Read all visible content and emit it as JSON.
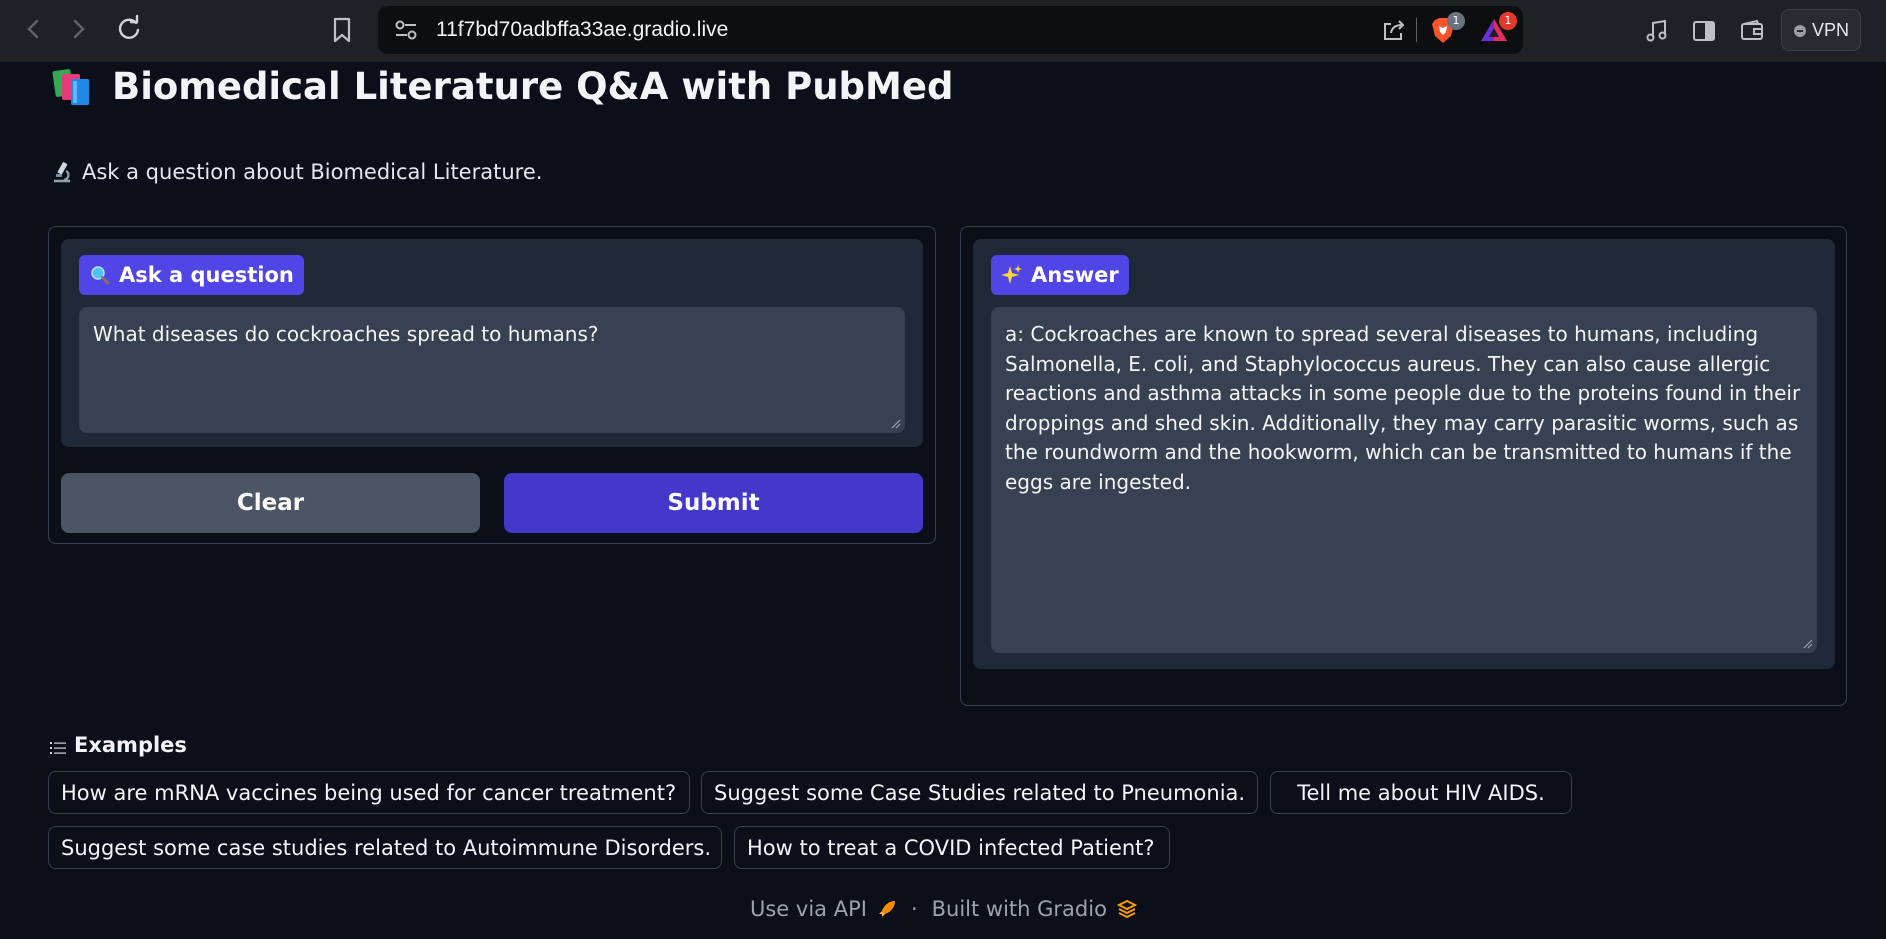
{
  "browser": {
    "url": "11f7bd70adbffa33ae.gradio.live",
    "brave_shields_count": "1",
    "rewards_count": "1",
    "vpn_label": "VPN",
    "icons": [
      "back-arrow-icon",
      "forward-arrow-icon",
      "reload-icon",
      "bookmark-icon",
      "site-settings-icon",
      "share-icon",
      "brave-shields-icon",
      "brave-rewards-icon",
      "media-icon",
      "sidebar-icon",
      "wallet-icon"
    ]
  },
  "page": {
    "title": "Biomedical Literature Q&A with PubMed",
    "subtitle": "Ask a question about Biomedical Literature.",
    "icons": [
      "books-icon",
      "microscope-icon"
    ]
  },
  "question_panel": {
    "label": "Ask a question",
    "label_icon": "magnifier-icon",
    "value": "What diseases do cockroaches spread to humans?",
    "clear_label": "Clear",
    "submit_label": "Submit"
  },
  "answer_panel": {
    "label": "Answer",
    "label_icon": "sparkles-icon",
    "value": "a: Cockroaches are known to spread several diseases to humans, including Salmonella, E. coli, and Staphylococcus aureus. They can also cause allergic reactions and asthma attacks in some people due to the proteins found in their droppings and shed skin. Additionally, they may carry parasitic worms, such as the roundworm and the hookworm, which can be transmitted to humans if the eggs are ingested."
  },
  "examples": {
    "heading": "Examples",
    "items": [
      "How are mRNA vaccines being used for cancer treatment?",
      "Suggest some Case Studies related to Pneumonia.",
      "Tell me about HIV AIDS.",
      "Suggest some case studies related to Autoimmune Disorders.",
      "How to treat a COVID infected Patient?"
    ]
  },
  "footer": {
    "api_label": "Use via API",
    "separator": "·",
    "built_label": "Built with Gradio"
  },
  "colors": {
    "background": "#0b0f19",
    "block": "#1f2937",
    "input": "#374151",
    "accent": "#4f46e5",
    "submit": "#4338ca",
    "clear": "#4b5563"
  }
}
